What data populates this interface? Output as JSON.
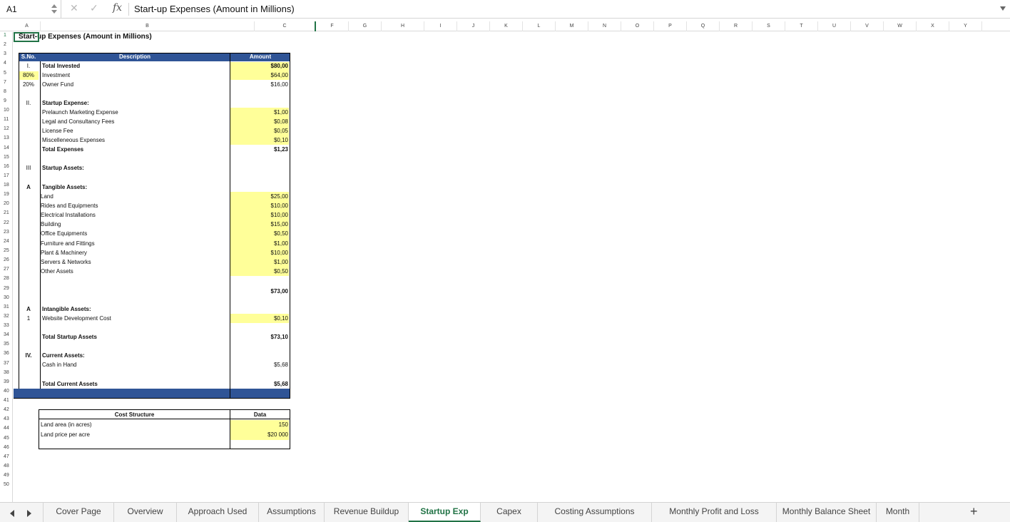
{
  "formula_bar": {
    "name_box": "A1",
    "formula": "Start-up Expenses (Amount in Millions)",
    "fx": "fx",
    "cancel": "✕",
    "confirm": "✓"
  },
  "columns": [
    "A",
    "B",
    "C",
    "F",
    "G",
    "H",
    "I",
    "J",
    "K",
    "L",
    "M",
    "N",
    "O",
    "P",
    "Q",
    "R",
    "S",
    "T",
    "U",
    "V",
    "W",
    "X",
    "Y"
  ],
  "rows": [
    "1",
    "2",
    "3",
    "4",
    "5",
    "7",
    "8",
    "9",
    "10",
    "11",
    "12",
    "13",
    "14",
    "15",
    "16",
    "17",
    "18",
    "19",
    "20",
    "21",
    "22",
    "23",
    "24",
    "25",
    "26",
    "27",
    "28",
    "29",
    "30",
    "31",
    "32",
    "33",
    "34",
    "35",
    "36",
    "37",
    "38",
    "39",
    "40",
    "41",
    "42",
    "43",
    "44",
    "45",
    "46",
    "47",
    "48",
    "49",
    "50"
  ],
  "sheet": {
    "title": "Start-up Expenses (Amount in Millions)",
    "header": {
      "sno": "S.No.",
      "description": "Description",
      "amount": "Amount"
    },
    "s1": {
      "num": "I.",
      "label": "Total Invested",
      "value": "$80,00",
      "items": [
        {
          "pct": "80%",
          "label": "Investment",
          "value": "$64,00"
        },
        {
          "pct": "20%",
          "label": "Owner Fund",
          "value": "$16,00"
        }
      ]
    },
    "s2": {
      "num": "II.",
      "label": "Startup Expense:",
      "items": [
        {
          "label": "Prelaunch Marketing Expense",
          "value": "$1,00"
        },
        {
          "label": "Legal and Consultancy Fees",
          "value": "$0,08"
        },
        {
          "label": "License Fee",
          "value": "$0,05"
        },
        {
          "label": "Miscelleneous Expenses",
          "value": "$0,10"
        }
      ],
      "total_label": "Total Expenses",
      "total_value": "$1,23"
    },
    "s3": {
      "num": "III",
      "label": "Startup Assets:"
    },
    "tangible": {
      "num": "A",
      "label": "Tangible Assets:",
      "items": [
        {
          "label": "Land",
          "value": "$25,00"
        },
        {
          "label": "Rides and Equipments",
          "value": "$10,00"
        },
        {
          "label": "Electrical Installations",
          "value": "$10,00"
        },
        {
          "label": "Building",
          "value": "$15,00"
        },
        {
          "label": "Office Equipments",
          "value": "$0,50"
        },
        {
          "label": "Furniture and Fittings",
          "value": "$1,00"
        },
        {
          "label": "Plant & Machinery",
          "value": "$10,00"
        },
        {
          "label": "Servers & Networks",
          "value": "$1,00"
        },
        {
          "label": "Other Assets",
          "value": "$0,50"
        }
      ],
      "total_value": "$73,00"
    },
    "intangible": {
      "num": "A",
      "label": "Intangible Assets:",
      "item_num": "1",
      "item_label": "Website Development Cost",
      "item_value": "$0,10"
    },
    "total_startup": {
      "label": "Total Startup  Assets",
      "value": "$73,10"
    },
    "s4": {
      "num": "IV.",
      "label": "Current Assets:",
      "item_label": "Cash in Hand",
      "item_value": "$5,68",
      "total_label": "Total Current Assets",
      "total_value": "$5,68"
    },
    "cost_structure": {
      "header": "Cost Structure",
      "data_header": "Data",
      "items": [
        {
          "label": "Land area (in acres)",
          "value": "150"
        },
        {
          "label": "Land price per acre",
          "value": "$20 000"
        }
      ]
    }
  },
  "tabs": [
    "Cover Page",
    "Overview",
    "Approach Used",
    "Assumptions",
    "Revenue Buildup",
    "Startup Exp",
    "Capex",
    "Costing Assumptions",
    "Monthly Profit and Loss",
    "Monthly Balance Sheet",
    "Month"
  ],
  "active_tab": "Startup Exp",
  "add_tab": "+",
  "colors": {
    "accent": "#217346",
    "header_blue": "#2f5496",
    "highlight": "#ffff99"
  }
}
